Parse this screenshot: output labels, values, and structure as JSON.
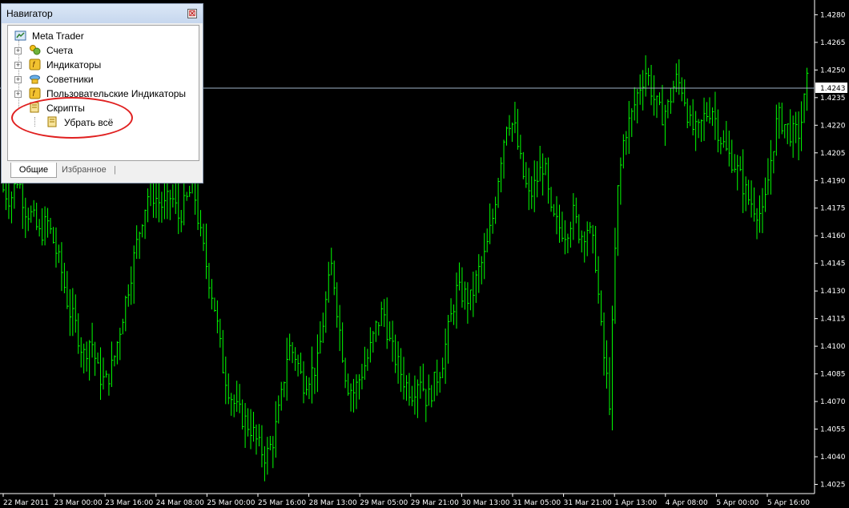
{
  "chart": {
    "background": "#000000",
    "bar_color": "#00ff00",
    "current_price": "1.4243",
    "price_range": [
      1.402,
      1.4288
    ],
    "price_ticks": [
      "1.4280",
      "1.4265",
      "1.4250",
      "1.4235",
      "1.4220",
      "1.4205",
      "1.4190",
      "1.4175",
      "1.4160",
      "1.4145",
      "1.4130",
      "1.4115",
      "1.4100",
      "1.4085",
      "1.4070",
      "1.4055",
      "1.4040",
      "1.4025"
    ],
    "time_labels": [
      "22 Mar 2011",
      "23 Mar 00:00",
      "23 Mar 16:00",
      "24 Mar 08:00",
      "25 Mar 00:00",
      "25 Mar 16:00",
      "28 Mar 13:00",
      "29 Mar 05:00",
      "29 Mar 21:00",
      "30 Mar 13:00",
      "31 Mar 05:00",
      "31 Mar 21:00",
      "1 Apr 13:00",
      "4 Apr 08:00",
      "5 Apr 00:00",
      "5 Apr 16:00"
    ]
  },
  "chart_data": {
    "type": "candlestick",
    "series_close": [
      1.4185,
      1.418,
      1.4192,
      1.4175,
      1.417,
      1.416,
      1.4168,
      1.4155,
      1.414,
      1.412,
      1.411,
      1.4095,
      1.4105,
      1.4085,
      1.408,
      1.409,
      1.411,
      1.413,
      1.415,
      1.417,
      1.4185,
      1.418,
      1.4175,
      1.4182,
      1.417,
      1.4178,
      1.4188,
      1.416,
      1.414,
      1.412,
      1.409,
      1.4075,
      1.4065,
      1.406,
      1.4055,
      1.4045,
      1.404,
      1.405,
      1.407,
      1.41,
      1.4095,
      1.408,
      1.4085,
      1.409,
      1.412,
      1.4145,
      1.411,
      1.408,
      1.4075,
      1.4085,
      1.4095,
      1.411,
      1.412,
      1.41,
      1.409,
      1.408,
      1.4075,
      1.4085,
      1.407,
      1.408,
      1.409,
      1.411,
      1.413,
      1.4128,
      1.4125,
      1.414,
      1.415,
      1.417,
      1.42,
      1.4225,
      1.4218,
      1.4195,
      1.418,
      1.419,
      1.42,
      1.417,
      1.4165,
      1.4162,
      1.4172,
      1.416,
      1.4165,
      1.415,
      1.41,
      1.407,
      1.418,
      1.4215,
      1.4225,
      1.424,
      1.425,
      1.4235,
      1.4225,
      1.423,
      1.4245,
      1.424,
      1.422,
      1.4215,
      1.4225,
      1.423,
      1.4215,
      1.4205,
      1.42,
      1.419,
      1.418,
      1.4175,
      1.417,
      1.42,
      1.4225,
      1.422,
      1.4215,
      1.4216,
      1.4243
    ]
  },
  "navigator": {
    "title": "Навигатор",
    "close_glyph": "⊠",
    "tree": [
      {
        "label": "Meta Trader",
        "icon": "metatrader-icon"
      },
      {
        "label": "Счета",
        "icon": "accounts-icon"
      },
      {
        "label": "Индикаторы",
        "icon": "indicators-icon"
      },
      {
        "label": "Советники",
        "icon": "experts-icon"
      },
      {
        "label": "Пользовательские Индикаторы",
        "icon": "custom-indicators-icon"
      },
      {
        "label": "Скрипты",
        "icon": "scripts-icon"
      },
      {
        "label": "Убрать всё",
        "icon": "script-icon"
      }
    ],
    "expander_glyph": "+",
    "tabs": [
      "Общие",
      "Избранное"
    ],
    "highlight_color": "#e02020"
  }
}
